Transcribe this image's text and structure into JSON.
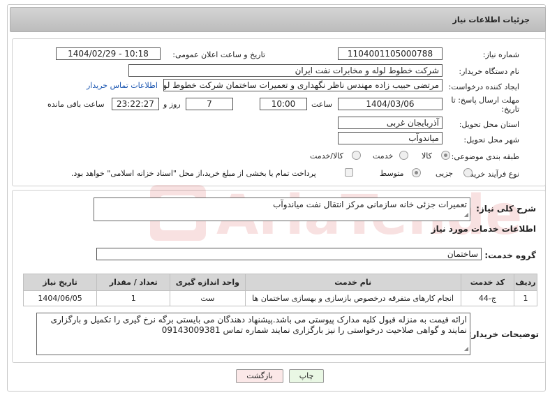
{
  "header": {
    "title": "جزئیات اطلاعات نیاز"
  },
  "fields": {
    "need_number_label": "شماره نیاز:",
    "need_number": "1104001105000788",
    "announce_label": "تاریخ و ساعت اعلان عمومی:",
    "announce_value": "1404/02/29 - 10:18",
    "buyer_org_label": "نام دستگاه خریدار:",
    "buyer_org": "شرکت خطوط لوله و مخابرات نفت ایران",
    "creator_label": "ایجاد کننده درخواست:",
    "creator": "مرتضی حبیب زاده مهندس ناظر نگهداری و تعمیرات ساختمان شرکت خطوط لوله",
    "contact_link": "اطلاعات تماس خریدار",
    "deadline_label_1": "مهلت ارسال پاسخ: تا",
    "deadline_label_2": "تاریخ:",
    "deadline_date": "1404/03/06",
    "time_label": "ساعت",
    "deadline_time": "10:00",
    "days_value": "7",
    "days_label": "روز و",
    "remaining_time": "23:22:27",
    "remaining_label": "ساعت باقی مانده",
    "province_label": "استان محل تحویل:",
    "province": "آذربایجان غربی",
    "city_label": "شهر محل تحویل:",
    "city": "میاندوآب",
    "category_label": "طبقه بندی موضوعی:",
    "category_options": [
      "کالا",
      "خدمت",
      "کالا/خدمت"
    ],
    "process_label": "نوع فرآیند خرید :",
    "process_options": [
      "جزیی",
      "متوسط"
    ],
    "payment_note": "پرداخت تمام یا بخشی از مبلغ خرید،از محل \"اسناد خزانه اسلامی\" خواهد بود."
  },
  "description": {
    "label": "شرح کلی نیاز:",
    "text": "تعمیرات جزئی خانه سازمانی مرکز انتقال نفت میاندوآب"
  },
  "services": {
    "section_title": "اطلاعات خدمات مورد نیاز",
    "group_label": "گروه خدمت:",
    "group_value": "ساختمان",
    "columns": [
      "ردیف",
      "کد خدمت",
      "نام خدمت",
      "واحد اندازه گیری",
      "تعداد / مقدار",
      "تاریخ نیاز"
    ],
    "rows": [
      [
        "1",
        "ج-44",
        "انجام کارهای متفرقه درخصوص بازسازی و بهسازی ساختمان ها",
        "ست",
        "1",
        "1404/06/05"
      ]
    ]
  },
  "buyer_notes": {
    "label": "توضیحات خریدار:",
    "text": "ارائه قیمت به منزله قبول کلیه مدارک پیوستی می باشد.پیشنهاد دهندگان می بایستی برگه نرخ گیری را تکمیل و بارگزاری نمایند و گواهی صلاحیت درخواستی را نیز بارگزاری نمایند شماره تماس 09143009381"
  },
  "buttons": {
    "print": "چاپ",
    "back": "بازگشت"
  },
  "colors": {
    "print_bg": "#e9f7e4",
    "back_bg": "#fbe8e8",
    "link": "#1a55b0",
    "watermark": "#cc2222"
  }
}
